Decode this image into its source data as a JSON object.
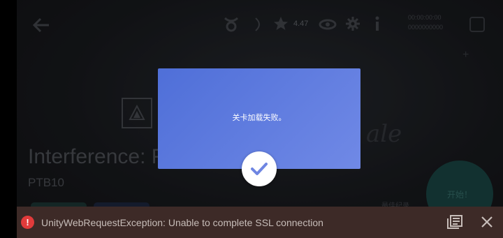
{
  "header": {
    "rating": "4.47",
    "top_right_line1": "00:00:00:00",
    "top_right_line2": "0000000000"
  },
  "level": {
    "title": "Interference: F",
    "code": "PTB10",
    "start_label": "开始！",
    "records_label": "最佳纪录"
  },
  "dialog": {
    "message": "关卡加载失败。"
  },
  "error_bar": {
    "message": "UnityWebRequestException: Unable to complete SSL connection"
  },
  "colors": {
    "dialog_start": "#4f6fd8",
    "dialog_end": "#7089e6",
    "error_red": "#e23b3b",
    "error_bar_bg": "#3d2a27"
  }
}
